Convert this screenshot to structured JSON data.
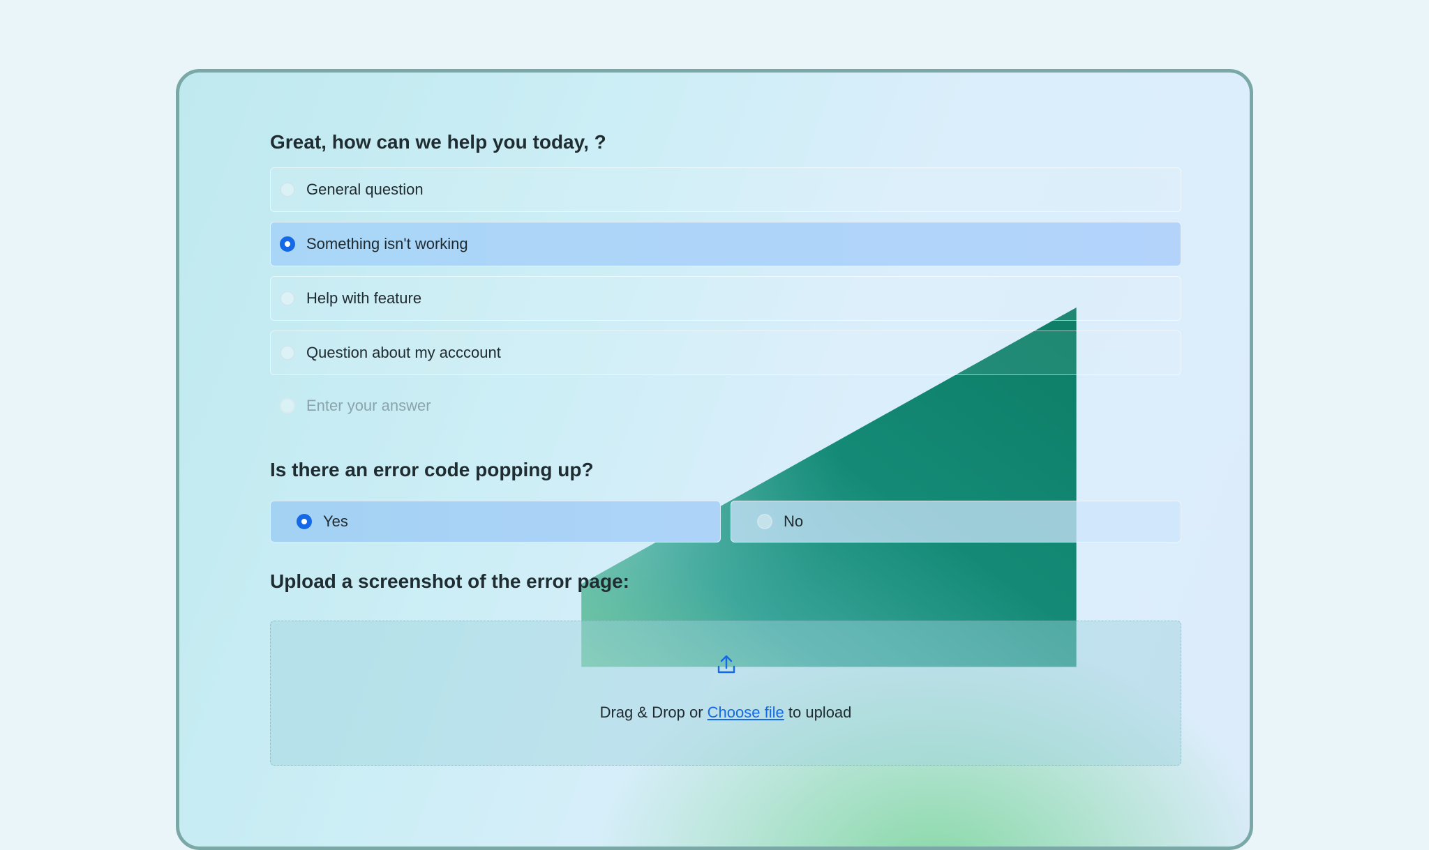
{
  "form": {
    "help_question": "Great, how can we help you today, ?",
    "help_options": [
      {
        "label": "General question",
        "selected": false
      },
      {
        "label": "Something isn't working",
        "selected": true
      },
      {
        "label": "Help with feature",
        "selected": false
      },
      {
        "label": "Question about my acccount",
        "selected": false
      }
    ],
    "other_placeholder": "Enter your answer",
    "error_question": "Is there an error code popping up?",
    "error_options": [
      {
        "label": "Yes",
        "selected": true
      },
      {
        "label": "No",
        "selected": false
      }
    ],
    "upload_question": "Upload a screenshot of the error page:",
    "upload": {
      "icon": "upload-icon",
      "text_before": "Drag & Drop or",
      "link": "Choose file",
      "text_after": "to upload"
    }
  },
  "colors": {
    "accent": "#1669e6",
    "selected_bg": "#a9d6f7",
    "decor_green": "#118270"
  }
}
